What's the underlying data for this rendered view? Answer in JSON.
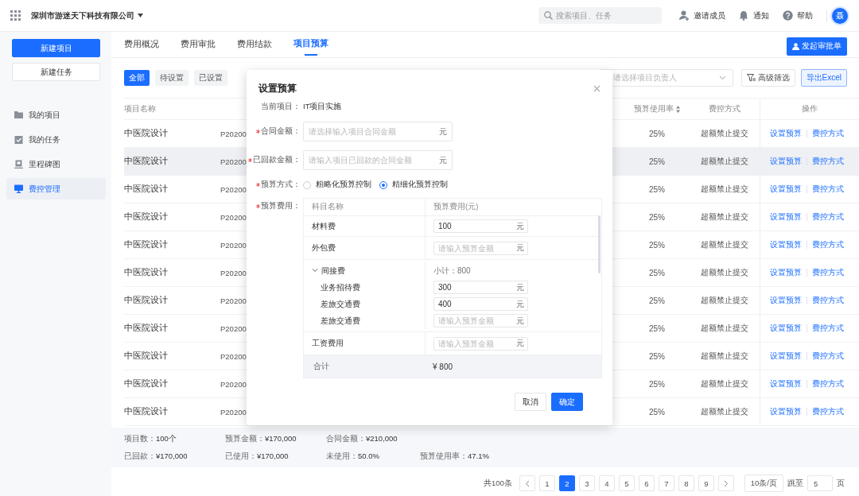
{
  "header": {
    "company": "深圳市游迷天下科技有限公司",
    "search": {
      "placeholder": "搜索项目、任务"
    },
    "actions": [
      {
        "label": "邀请成员"
      },
      {
        "label": "通知"
      },
      {
        "label": "帮助"
      }
    ],
    "avatar": "聂"
  },
  "sidebar": {
    "buttons": [
      {
        "label": "新建项目",
        "kind": "primary"
      },
      {
        "label": "新建任务",
        "kind": "default"
      }
    ],
    "items": [
      {
        "label": "我的项目",
        "selected": false
      },
      {
        "label": "我的任务",
        "selected": false
      },
      {
        "label": "里程碑图",
        "selected": false
      },
      {
        "label": "费控管理",
        "selected": true
      }
    ]
  },
  "tabs": [
    {
      "label": "费用概况",
      "selected": false
    },
    {
      "label": "费用审批",
      "selected": false
    },
    {
      "label": "费用结款",
      "selected": false
    },
    {
      "label": "项目预算",
      "selected": true
    }
  ],
  "primary_action": "发起审批单",
  "filters": [
    {
      "label": "全部",
      "selected": true
    },
    {
      "label": "待设置",
      "selected": false
    },
    {
      "label": "已设置",
      "selected": false
    }
  ],
  "owner_select": {
    "placeholder": "请选择项目负责人"
  },
  "advanced_filter": "高级筛选",
  "export": "导出Excel",
  "table": {
    "columns": [
      {
        "label": "项目名称",
        "sortable": false
      },
      {
        "label": "预算使用率",
        "sortable": true
      },
      {
        "label": "费控方式",
        "sortable": false
      },
      {
        "label": "操作",
        "sortable": false
      }
    ],
    "rows": [
      {
        "name": "中医院设计",
        "code": "P20200",
        "usage": "25%",
        "control": "超额禁止提交",
        "actions": [
          "设置预算",
          "费控方式"
        ],
        "highlighted": false
      },
      {
        "name": "中医院设计",
        "code": "P20200",
        "usage": "25%",
        "control": "超额禁止提交",
        "actions": [
          "设置预算",
          "费控方式"
        ],
        "highlighted": true
      },
      {
        "name": "中医院设计",
        "code": "P20200",
        "usage": "25%",
        "control": "超额禁止提交",
        "actions": [
          "设置预算",
          "费控方式"
        ],
        "highlighted": false
      },
      {
        "name": "中医院设计",
        "code": "P20200",
        "usage": "25%",
        "control": "超额禁止提交",
        "actions": [
          "设置预算",
          "费控方式"
        ],
        "highlighted": false
      },
      {
        "name": "中医院设计",
        "code": "P20200",
        "usage": "25%",
        "control": "超额禁止提交",
        "actions": [
          "设置预算",
          "费控方式"
        ],
        "highlighted": false
      },
      {
        "name": "中医院设计",
        "code": "P20200",
        "usage": "25%",
        "control": "超额禁止提交",
        "actions": [
          "设置预算",
          "费控方式"
        ],
        "highlighted": false
      },
      {
        "name": "中医院设计",
        "code": "P20200",
        "usage": "25%",
        "control": "超额禁止提交",
        "actions": [
          "设置预算",
          "费控方式"
        ],
        "highlighted": false
      },
      {
        "name": "中医院设计",
        "code": "P20200",
        "usage": "25%",
        "control": "超额禁止提交",
        "actions": [
          "设置预算",
          "费控方式"
        ],
        "highlighted": false
      },
      {
        "name": "中医院设计",
        "code": "P20200",
        "usage": "25%",
        "control": "超额禁止提交",
        "actions": [
          "设置预算",
          "费控方式"
        ],
        "highlighted": false
      },
      {
        "name": "中医院设计",
        "code": "P20200",
        "usage": "25%",
        "control": "超额禁止提交",
        "actions": [
          "设置预算",
          "费控方式"
        ],
        "highlighted": false
      },
      {
        "name": "中医院设计",
        "code": "P20200",
        "usage": "25%",
        "control": "超额禁止提交",
        "actions": [
          "设置预算",
          "费控方式"
        ],
        "highlighted": false
      }
    ]
  },
  "summary": [
    [
      {
        "label": "项目数：",
        "value": "100个"
      },
      {
        "label": "预算金额：",
        "value": "¥170,000"
      },
      {
        "label": "合同金额：",
        "value": "¥210,000"
      }
    ],
    [
      {
        "label": "已回款：",
        "value": "¥170,000"
      },
      {
        "label": "已使用：",
        "value": "¥170,000"
      },
      {
        "label": "未使用：",
        "value": "50.0%"
      },
      {
        "label": "预算使用率：",
        "value": "47.1%"
      }
    ]
  ],
  "pagination": {
    "total": "共100条",
    "pages": [
      {
        "label": "1",
        "selected": false
      },
      {
        "label": "2",
        "selected": true
      },
      {
        "label": "3",
        "selected": false
      },
      {
        "label": "4",
        "selected": false
      },
      {
        "label": "5",
        "selected": false
      },
      {
        "label": "6",
        "selected": false
      },
      {
        "label": "7",
        "selected": false
      },
      {
        "label": "8",
        "selected": false
      },
      {
        "label": "9",
        "selected": false
      }
    ],
    "page_size": "10条/页",
    "jump_label": "跳至",
    "jump_value": "5",
    "jump_unit": "页"
  },
  "modal": {
    "title": "设置预算",
    "current_project": {
      "label": "当前项目：",
      "value": "IT项目实施"
    },
    "fields": [
      {
        "label": "合同金额：",
        "required": true,
        "placeholder": "请选择输入项目合同金额",
        "unit": "元"
      },
      {
        "label": "已回款金额：",
        "required": true,
        "placeholder": "请输入项目已回款的合同金额",
        "unit": "元"
      }
    ],
    "method": {
      "label": "预算方式：",
      "required": true,
      "options": [
        {
          "label": "粗略化预算控制",
          "selected": false
        },
        {
          "label": "精细化预算控制",
          "selected": true
        }
      ]
    },
    "costs": {
      "label": "预算费用：",
      "required": true,
      "columns": [
        "科目名称",
        "预算费用(元)"
      ],
      "rows": [
        {
          "name": "材料费",
          "value": "100",
          "unit": "元"
        },
        {
          "name": "外包费",
          "placeholder": "请输入预算金额",
          "unit": "元"
        },
        {
          "name": "间接费",
          "expanded": true,
          "subtotal": "小计：800",
          "children": [
            {
              "name": "业务招待费",
              "value": "300",
              "unit": "元"
            },
            {
              "name": "差旅交通费",
              "value": "400",
              "unit": "元"
            },
            {
              "name": "差旅交通费",
              "placeholder": "请输入预算金额",
              "unit": "元"
            }
          ]
        },
        {
          "name": "工资费用",
          "placeholder": "请输入预算金额",
          "unit": "元"
        }
      ],
      "total": {
        "label": "合计",
        "value": "¥ 800"
      }
    },
    "buttons": [
      {
        "label": "取消",
        "kind": "default"
      },
      {
        "label": "确定",
        "kind": "primary"
      }
    ]
  }
}
